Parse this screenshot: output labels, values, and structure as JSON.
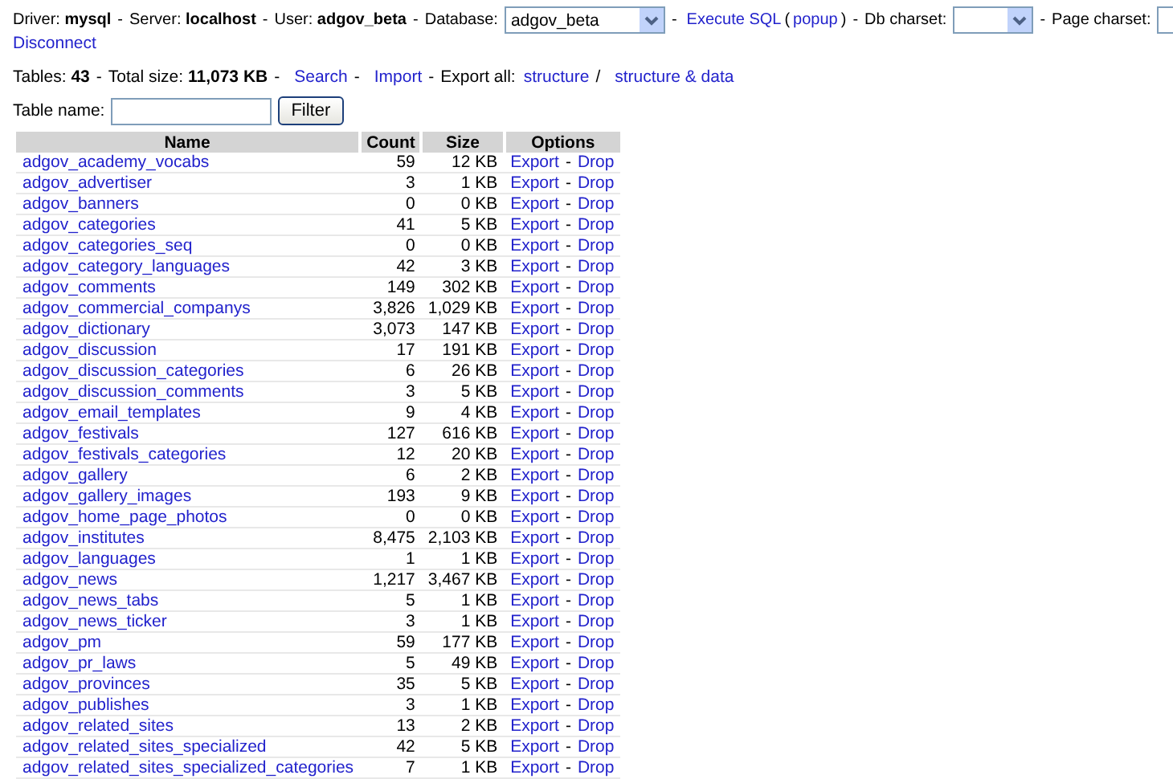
{
  "header": {
    "parts": [
      {
        "kind": "text",
        "text": "Driver: **mysql**"
      },
      {
        "kind": "sep",
        "text": "-"
      },
      {
        "kind": "text",
        "text": "Server: **localhost**"
      },
      {
        "kind": "sep",
        "text": "-"
      },
      {
        "kind": "text",
        "text": "User: **adgov_beta**"
      },
      {
        "kind": "sep",
        "text": "-"
      },
      {
        "kind": "text",
        "text": "Database:"
      },
      {
        "kind": "db_select",
        "value": "adgov_beta"
      },
      {
        "kind": "sep",
        "text": "-"
      },
      {
        "kind": "link",
        "text": "Execute SQL"
      },
      {
        "kind": "text",
        "text": "("
      },
      {
        "kind": "link",
        "text": "popup"
      },
      {
        "kind": "text",
        "text": ")"
      },
      {
        "kind": "sep",
        "text": "-"
      },
      {
        "kind": "text",
        "text": "Db charset:"
      },
      {
        "kind": "charset_select"
      },
      {
        "kind": "sep",
        "text": "-"
      },
      {
        "kind": "text",
        "text": "Page charset:"
      },
      {
        "kind": "input"
      }
    ],
    "disconnect": "Disconnect"
  },
  "summary": {
    "parts": [
      {
        "kind": "text",
        "text": "Tables: **43**"
      },
      {
        "kind": "sep",
        "text": "-"
      },
      {
        "kind": "text",
        "text": "Total size: **11,073 KB**"
      },
      {
        "kind": "sep",
        "text": "-"
      },
      {
        "kind": "link",
        "text": "Search"
      },
      {
        "kind": "sep",
        "text": "-"
      },
      {
        "kind": "link",
        "text": "Import"
      },
      {
        "kind": "sep",
        "text": "-"
      },
      {
        "kind": "text",
        "text": "Export all:"
      },
      {
        "kind": "link",
        "text": "structure"
      },
      {
        "kind": "sep",
        "text": "/"
      },
      {
        "kind": "link",
        "text": "structure & data"
      }
    ]
  },
  "filter": {
    "label": "Table name:",
    "button": "Filter"
  },
  "table": {
    "columns": [
      "Name",
      "Count",
      "Size",
      "Options"
    ],
    "rows": [
      {
        "name": "adgov_academy_vocabs",
        "count": "59",
        "size": "12 KB",
        "export": "Export",
        "sep": "-",
        "drop": "Drop"
      },
      {
        "name": "adgov_advertiser",
        "count": "3",
        "size": "1 KB",
        "export": "Export",
        "sep": "-",
        "drop": "Drop"
      },
      {
        "name": "adgov_banners",
        "count": "0",
        "size": "0 KB",
        "export": "Export",
        "sep": "-",
        "drop": "Drop"
      },
      {
        "name": "adgov_categories",
        "count": "41",
        "size": "5 KB",
        "export": "Export",
        "sep": "-",
        "drop": "Drop"
      },
      {
        "name": "adgov_categories_seq",
        "count": "0",
        "size": "0 KB",
        "export": "Export",
        "sep": "-",
        "drop": "Drop"
      },
      {
        "name": "adgov_category_languages",
        "count": "42",
        "size": "3 KB",
        "export": "Export",
        "sep": "-",
        "drop": "Drop"
      },
      {
        "name": "adgov_comments",
        "count": "149",
        "size": "302 KB",
        "export": "Export",
        "sep": "-",
        "drop": "Drop"
      },
      {
        "name": "adgov_commercial_companys",
        "count": "3,826",
        "size": "1,029 KB",
        "export": "Export",
        "sep": "-",
        "drop": "Drop"
      },
      {
        "name": "adgov_dictionary",
        "count": "3,073",
        "size": "147 KB",
        "export": "Export",
        "sep": "-",
        "drop": "Drop"
      },
      {
        "name": "adgov_discussion",
        "count": "17",
        "size": "191 KB",
        "export": "Export",
        "sep": "-",
        "drop": "Drop"
      },
      {
        "name": "adgov_discussion_categories",
        "count": "6",
        "size": "26 KB",
        "export": "Export",
        "sep": "-",
        "drop": "Drop"
      },
      {
        "name": "adgov_discussion_comments",
        "count": "3",
        "size": "5 KB",
        "export": "Export",
        "sep": "-",
        "drop": "Drop"
      },
      {
        "name": "adgov_email_templates",
        "count": "9",
        "size": "4 KB",
        "export": "Export",
        "sep": "-",
        "drop": "Drop"
      },
      {
        "name": "adgov_festivals",
        "count": "127",
        "size": "616 KB",
        "export": "Export",
        "sep": "-",
        "drop": "Drop"
      },
      {
        "name": "adgov_festivals_categories",
        "count": "12",
        "size": "20 KB",
        "export": "Export",
        "sep": "-",
        "drop": "Drop"
      },
      {
        "name": "adgov_gallery",
        "count": "6",
        "size": "2 KB",
        "export": "Export",
        "sep": "-",
        "drop": "Drop"
      },
      {
        "name": "adgov_gallery_images",
        "count": "193",
        "size": "9 KB",
        "export": "Export",
        "sep": "-",
        "drop": "Drop"
      },
      {
        "name": "adgov_home_page_photos",
        "count": "0",
        "size": "0 KB",
        "export": "Export",
        "sep": "-",
        "drop": "Drop"
      },
      {
        "name": "adgov_institutes",
        "count": "8,475",
        "size": "2,103 KB",
        "export": "Export",
        "sep": "-",
        "drop": "Drop"
      },
      {
        "name": "adgov_languages",
        "count": "1",
        "size": "1 KB",
        "export": "Export",
        "sep": "-",
        "drop": "Drop"
      },
      {
        "name": "adgov_news",
        "count": "1,217",
        "size": "3,467 KB",
        "export": "Export",
        "sep": "-",
        "drop": "Drop"
      },
      {
        "name": "adgov_news_tabs",
        "count": "5",
        "size": "1 KB",
        "export": "Export",
        "sep": "-",
        "drop": "Drop"
      },
      {
        "name": "adgov_news_ticker",
        "count": "3",
        "size": "1 KB",
        "export": "Export",
        "sep": "-",
        "drop": "Drop"
      },
      {
        "name": "adgov_pm",
        "count": "59",
        "size": "177 KB",
        "export": "Export",
        "sep": "-",
        "drop": "Drop"
      },
      {
        "name": "adgov_pr_laws",
        "count": "5",
        "size": "49 KB",
        "export": "Export",
        "sep": "-",
        "drop": "Drop"
      },
      {
        "name": "adgov_provinces",
        "count": "35",
        "size": "5 KB",
        "export": "Export",
        "sep": "-",
        "drop": "Drop"
      },
      {
        "name": "adgov_publishes",
        "count": "3",
        "size": "1 KB",
        "export": "Export",
        "sep": "-",
        "drop": "Drop"
      },
      {
        "name": "adgov_related_sites",
        "count": "13",
        "size": "2 KB",
        "export": "Export",
        "sep": "-",
        "drop": "Drop"
      },
      {
        "name": "adgov_related_sites_specialized",
        "count": "42",
        "size": "5 KB",
        "export": "Export",
        "sep": "-",
        "drop": "Drop"
      },
      {
        "name": "adgov_related_sites_specialized_categories",
        "count": "7",
        "size": "1 KB",
        "export": "Export",
        "sep": "-",
        "drop": "Drop"
      }
    ]
  }
}
